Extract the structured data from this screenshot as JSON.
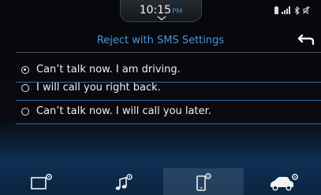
{
  "status": {
    "time": "10:15",
    "ampm": "PM",
    "icons": [
      "battery-icon",
      "signal-icon",
      "bluetooth-icon",
      "mute-icon"
    ]
  },
  "header": {
    "title": "Reject with SMS Settings",
    "back_icon": "back-arrow-icon"
  },
  "options": [
    {
      "label": "Can’t talk now. I am driving.",
      "selected": true
    },
    {
      "label": "I will call you right back.",
      "selected": false
    },
    {
      "label": "Can’t talk now. I will call you later.",
      "selected": false
    }
  ],
  "nav": {
    "items": [
      {
        "icon": "display-settings-icon",
        "active": false
      },
      {
        "icon": "music-settings-icon",
        "active": false
      },
      {
        "icon": "phone-settings-icon",
        "active": true
      },
      {
        "icon": "vehicle-settings-icon",
        "active": false
      }
    ]
  },
  "colors": {
    "accent": "#4a94e3",
    "text": "#f0f0f0",
    "divider": "#2f66a8"
  }
}
